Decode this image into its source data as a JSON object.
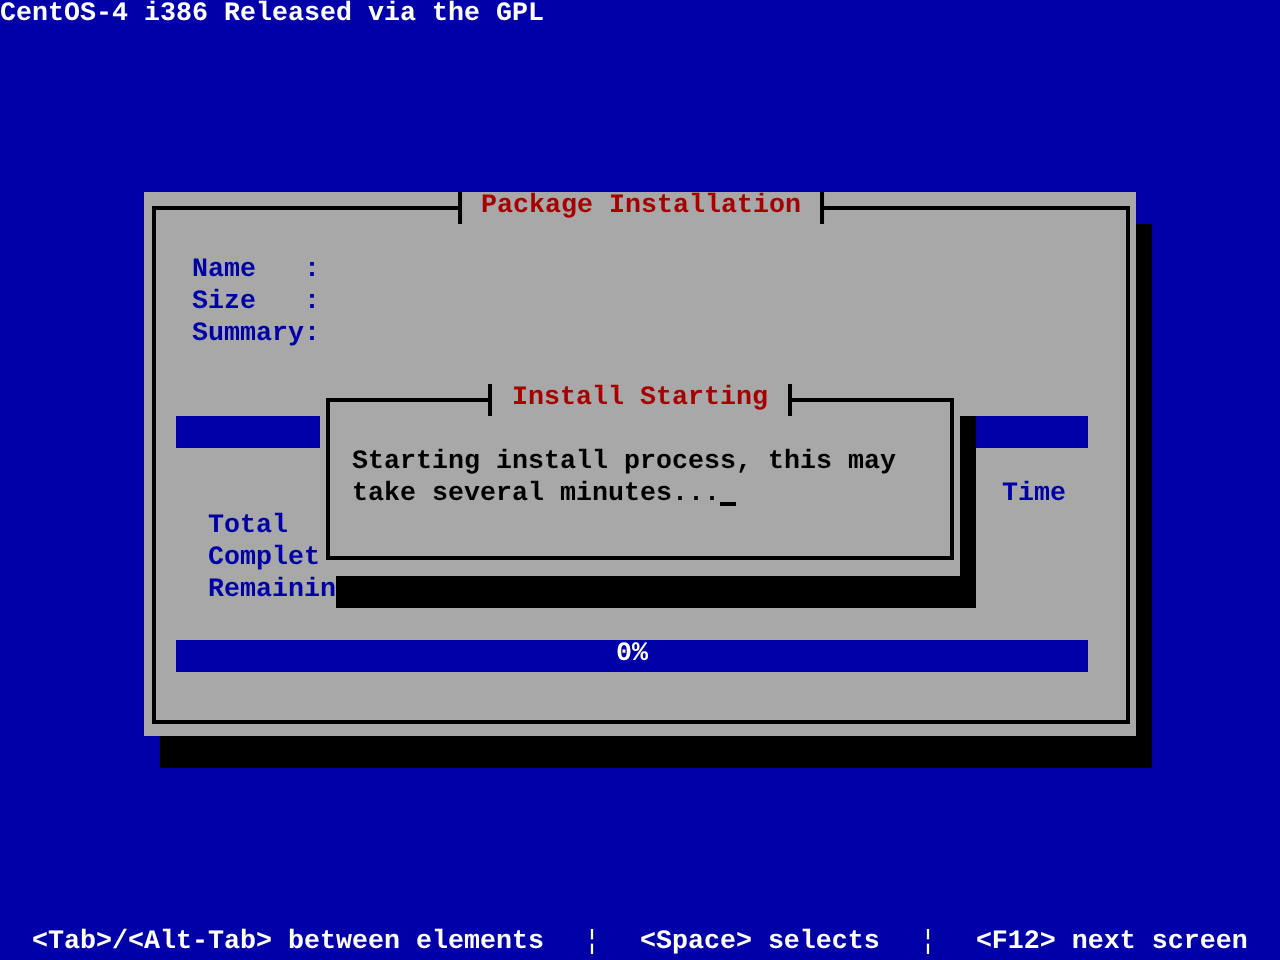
{
  "screen_title": "CentOS-4 i386 Released via the GPL",
  "window": {
    "title": "Package Installation",
    "fields": [
      {
        "label": "Name",
        "colon": ":"
      },
      {
        "label": "Size",
        "colon": ":"
      },
      {
        "label": "Summary",
        "colon": ":"
      }
    ],
    "package_progress": {
      "level": 0
    },
    "stats": {
      "columns": [
        "Time"
      ],
      "rows": [
        "Total",
        "Complet",
        "Remainin"
      ]
    },
    "overall_progress": {
      "level": 0,
      "reading": "0%"
    }
  },
  "dialog": {
    "title": "Install Starting",
    "lines": [
      "Starting install process, this may",
      "take several minutes..."
    ]
  },
  "help_bar": [
    {
      "kind": "hint",
      "text": "<Tab>/<Alt-Tab> between elements"
    },
    {
      "kind": "separator",
      "text": "¦"
    },
    {
      "kind": "hint",
      "text": "<Space> selects"
    },
    {
      "kind": "separator",
      "text": "¦"
    },
    {
      "kind": "hint",
      "text": "<F12> next screen"
    }
  ]
}
